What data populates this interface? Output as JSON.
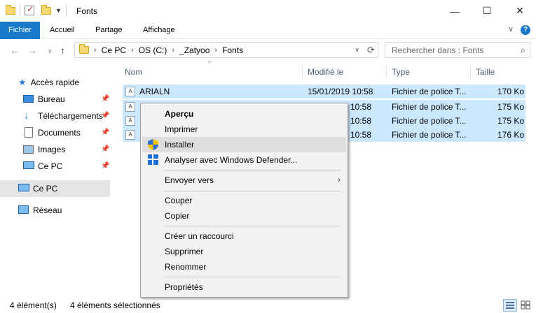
{
  "window": {
    "title": "Fonts",
    "minimize": "—",
    "maximize": "☐",
    "close": "✕"
  },
  "ribbon": {
    "tabs": [
      "Fichier",
      "Accueil",
      "Partage",
      "Affichage"
    ],
    "collapse_glyph": "∨",
    "help_glyph": "?"
  },
  "address": {
    "crumbs": [
      "Ce PC",
      "OS (C:)",
      "_Zatyoo",
      "Fonts"
    ],
    "search_placeholder": "Rechercher dans : Fonts"
  },
  "sidebar": {
    "quick_access": "Accès rapide",
    "items": [
      {
        "label": "Bureau",
        "icon": "desktop-icon",
        "pinned": true
      },
      {
        "label": "Téléchargements",
        "icon": "downloads-icon",
        "pinned": true
      },
      {
        "label": "Documents",
        "icon": "documents-icon",
        "pinned": true
      },
      {
        "label": "Images",
        "icon": "pictures-icon",
        "pinned": true
      },
      {
        "label": "Ce PC",
        "icon": "computer-icon",
        "pinned": true
      }
    ],
    "this_pc": "Ce PC",
    "network": "Réseau"
  },
  "columns": {
    "name": "Nom",
    "modified": "Modifié le",
    "type": "Type",
    "size": "Taille"
  },
  "files": [
    {
      "name": "ARIALN",
      "modified": "15/01/2019 10:58",
      "type": "Fichier de police T...",
      "size": "170 Ko"
    },
    {
      "name": "",
      "modified": "10:58",
      "type": "Fichier de police T...",
      "size": "175 Ko"
    },
    {
      "name": "",
      "modified": "10:58",
      "type": "Fichier de police T...",
      "size": "175 Ko"
    },
    {
      "name": "",
      "modified": "10:58",
      "type": "Fichier de police T...",
      "size": "176 Ko"
    }
  ],
  "context_menu": {
    "preview": "Aperçu",
    "print": "Imprimer",
    "install": "Installer",
    "scan": "Analyser avec Windows Defender...",
    "send_to": "Envoyer vers",
    "cut": "Couper",
    "copy": "Copier",
    "shortcut": "Créer un raccourci",
    "delete": "Supprimer",
    "rename": "Renommer",
    "properties": "Propriétés"
  },
  "status": {
    "count": "4 élément(s)",
    "selected": "4 éléments sélectionnés"
  },
  "colors": {
    "accent": "#1979ca",
    "selection": "#cce8ff",
    "menu_bg": "#f2f2f2"
  }
}
